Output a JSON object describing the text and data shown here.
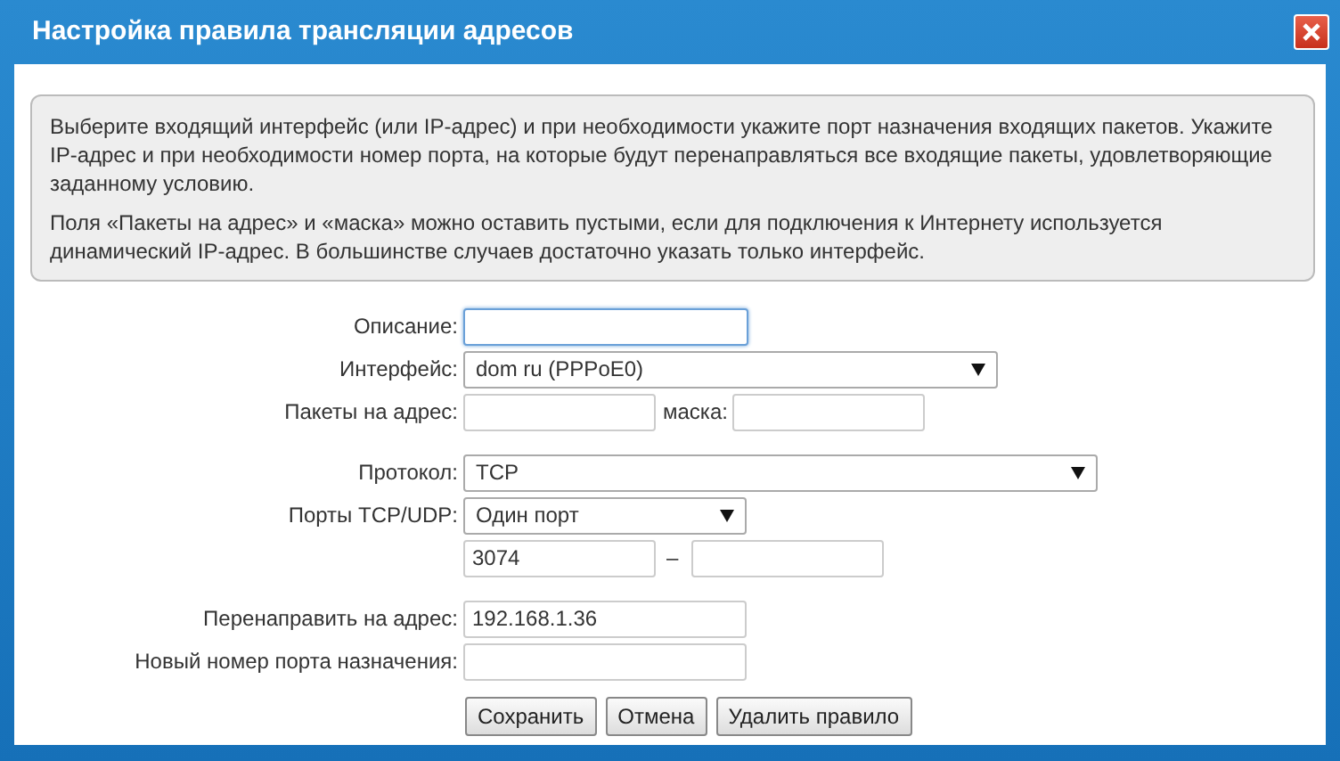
{
  "window": {
    "title": "Настройка правила трансляции адресов"
  },
  "info": [
    "Выберите входящий интерфейс (или IP-адрес) и при необходимости укажите порт назначения входящих пакетов. Укажите IP-адрес и при необходимости номер порта, на которые будут перенаправляться все входящие пакеты, удовлетворяющие заданному условию.",
    "Поля «Пакеты на адрес» и «маска» можно оставить пустыми, если для подключения к Интернету используется динамический IP-адрес. В большинстве случаев достаточно указать только интерфейс."
  ],
  "form": {
    "groups": [
      [
        {
          "label": "Описание:",
          "kind": "input",
          "focused": true
        },
        {
          "label": "Интерфейс:",
          "kind": "select",
          "value": "dom ru (PPPoE0)"
        },
        {
          "label": "Пакеты на адрес:",
          "kind": "pair",
          "second_label": "маска:"
        }
      ],
      [
        {
          "label": "Протокол:",
          "kind": "select",
          "value": "TCP"
        },
        {
          "label": "Порты TCP/UDP:",
          "kind": "select",
          "value": "Один порт"
        },
        {
          "kind": "range",
          "value": "3074",
          "separator": "–"
        }
      ],
      [
        {
          "label": "Перенаправить на адрес:",
          "kind": "input",
          "value": "192.168.1.36",
          "focused": false
        },
        {
          "label": "Новый номер порта назначения:",
          "kind": "input",
          "focused": false
        }
      ]
    ]
  },
  "buttons": [
    "Сохранить",
    "Отмена",
    "Удалить правило"
  ]
}
